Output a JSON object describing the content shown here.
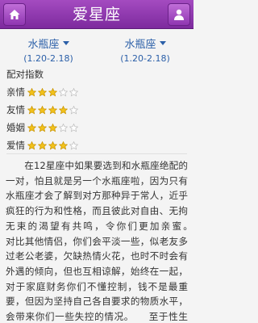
{
  "header": {
    "title": "爱星座",
    "home_icon": "home-icon",
    "user_icon": "user-icon",
    "accent": "#8a35ad"
  },
  "selectors": [
    {
      "name": "水瓶座",
      "range": "(1.20-2.18)"
    },
    {
      "name": "水瓶座",
      "range": "(1.20-2.18)"
    }
  ],
  "match": {
    "label": "配对指数",
    "ratings": [
      {
        "label": "亲情",
        "stars": 3,
        "max": 5
      },
      {
        "label": "友情",
        "stars": 4,
        "max": 5
      },
      {
        "label": "婚姻",
        "stars": 3,
        "max": 5
      },
      {
        "label": "爱情",
        "stars": 4,
        "max": 5
      }
    ]
  },
  "description": "在12星座中如果要选到和水瓶座绝配的一对，怕且就是另一个水瓶座啦，因为只有水瓶座才会了解到对方那种异于常人，近乎疯狂的行为和性格，而且彼此对自由、无拘无束的渴望有共鸣，令你们更加亲蜜。　　对比其他情侣，你们会平淡一些，似老友多过老公老婆，欠缺热情火花，也时不时会有外遇的倾向，但也互相谅解，始终在一起，对于家庭财务你们不懂控制，钱不是最重要，但因为坚持自己各自要求的物质水平，会带来你们一些失控的情况。　　至于性生活，只要你们多种兴趣的其中"
}
